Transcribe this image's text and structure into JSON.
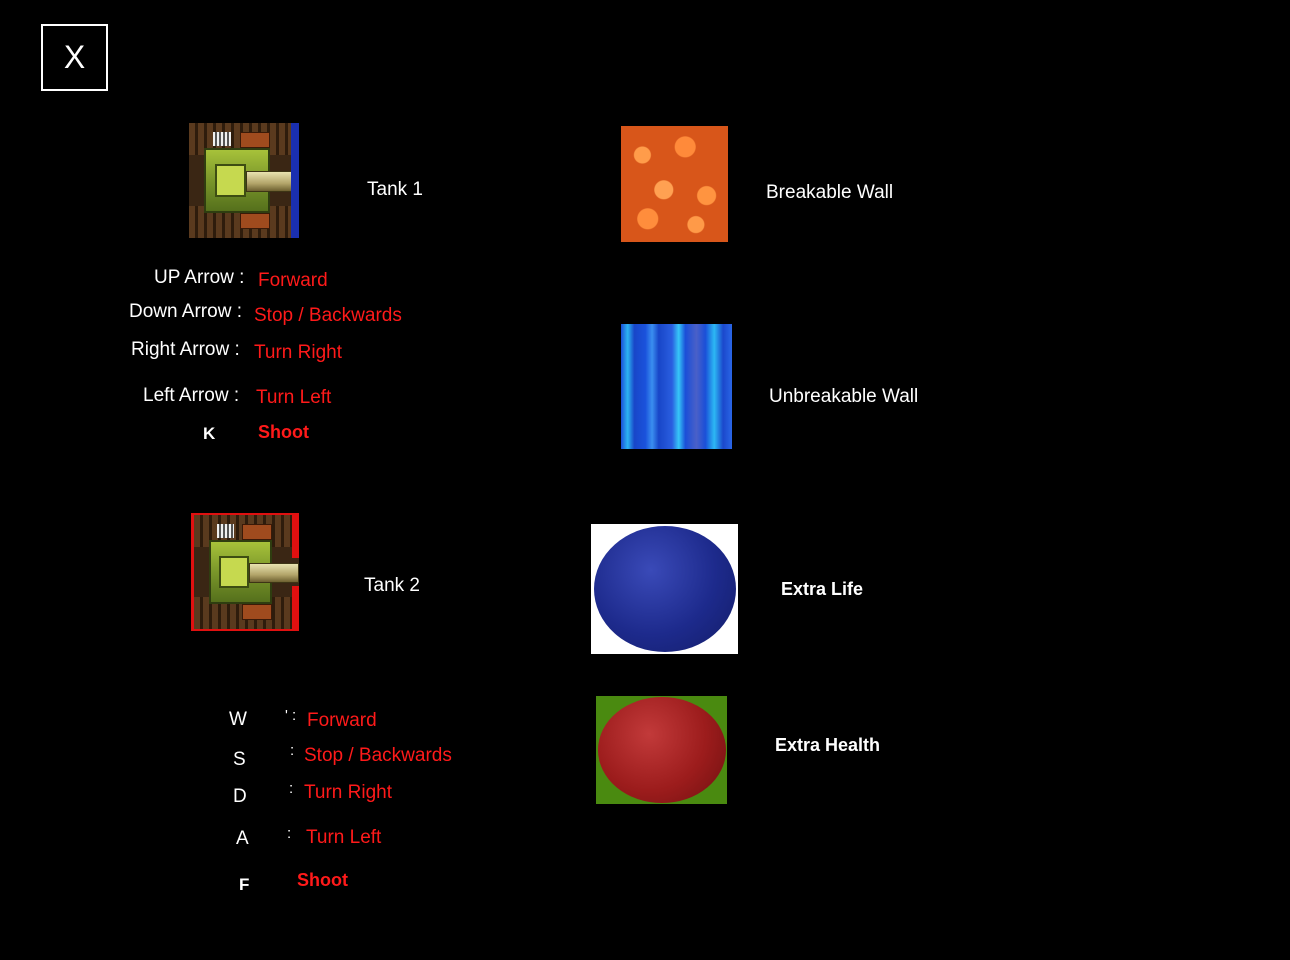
{
  "close_button": {
    "label": "X"
  },
  "tank1": {
    "name": "Tank 1",
    "controls": [
      {
        "key": "UP Arrow :",
        "action": "Forward"
      },
      {
        "key": "Down Arrow :",
        "action": "Stop / Backwards"
      },
      {
        "key": "Right Arrow :",
        "action": "Turn Right"
      },
      {
        "key": "Left Arrow :",
        "action": "Turn Left"
      },
      {
        "key": "K",
        "action": "Shoot"
      }
    ],
    "side_color": "#1a2fb0"
  },
  "tank2": {
    "name": "Tank 2",
    "controls": [
      {
        "key": "W",
        "sep": "' :",
        "action": "Forward"
      },
      {
        "key": "S",
        "sep": ":",
        "action": "Stop / Backwards"
      },
      {
        "key": "D",
        "sep": ":",
        "action": "Turn Right"
      },
      {
        "key": "A",
        "sep": ":",
        "action": "Turn Left"
      },
      {
        "key": "F",
        "sep": "",
        "action": "Shoot"
      }
    ],
    "side_color": "#e01010"
  },
  "items": {
    "breakable_wall": "Breakable Wall",
    "unbreakable_wall": "Unbreakable Wall",
    "extra_life": "Extra Life",
    "extra_health": "Extra Health"
  },
  "colors": {
    "background": "#000000",
    "text": "#ffffff",
    "action": "#ff1a1a",
    "extra_life_bg": "#ffffff",
    "extra_life_orb": "#1d2a8c",
    "extra_health_bg": "#4a8a10",
    "extra_health_orb": "#9c1c1c"
  }
}
